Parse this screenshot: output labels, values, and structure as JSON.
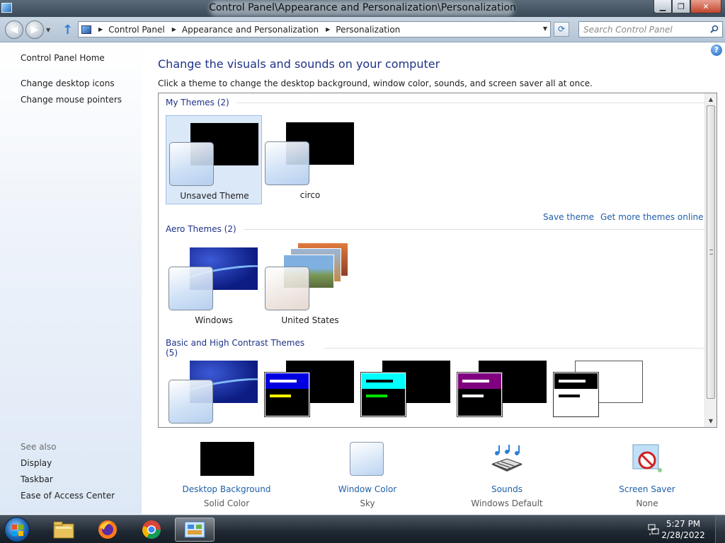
{
  "window": {
    "title": "Control Panel\\Appearance and Personalization\\Personalization",
    "minimize_glyph": "▁",
    "maximize_glyph": "❐",
    "close_glyph": "✕"
  },
  "address": {
    "crumbs": [
      "Control Panel",
      "Appearance and Personalization",
      "Personalization"
    ],
    "search_placeholder": "Search Control Panel"
  },
  "left_pane": {
    "home": "Control Panel Home",
    "links": [
      "Change desktop icons",
      "Change mouse pointers"
    ],
    "see_also_label": "See also",
    "see_also": [
      "Display",
      "Taskbar",
      "Ease of Access Center"
    ]
  },
  "main": {
    "title": "Change the visuals and sounds on your computer",
    "subtitle": "Click a theme to change the desktop background, window color, sounds, and screen saver all at once.",
    "groups": {
      "my_themes": "My Themes (2)",
      "aero_themes": "Aero Themes (2)",
      "basic_themes": "Basic and High Contrast Themes (5)"
    },
    "my_themes": [
      {
        "name": "Unsaved Theme",
        "selected": true
      },
      {
        "name": "circo",
        "selected": false
      }
    ],
    "aero_themes": [
      {
        "name": "Windows"
      },
      {
        "name": "United States"
      }
    ],
    "save_theme": "Save theme",
    "get_more": "Get more themes online",
    "help_glyph": "?"
  },
  "settings": [
    {
      "label": "Desktop Background",
      "value": "Solid Color",
      "icon": "solid-color-swatch-icon"
    },
    {
      "label": "Window Color",
      "value": "Sky",
      "icon": "window-color-swatch-icon"
    },
    {
      "label": "Sounds",
      "value": "Windows Default",
      "icon": "sounds-icon"
    },
    {
      "label": "Screen Saver",
      "value": "None",
      "icon": "screen-saver-icon"
    }
  ],
  "taskbar": {
    "time": "5:27 PM",
    "date": "2/28/2022",
    "pinned": [
      "file-explorer-icon",
      "firefox-icon",
      "chrome-icon",
      "control-panel-icon"
    ]
  },
  "colors": {
    "link": "#1f5fa8",
    "heading": "#1e3287",
    "selection": "#dbe8f8"
  }
}
